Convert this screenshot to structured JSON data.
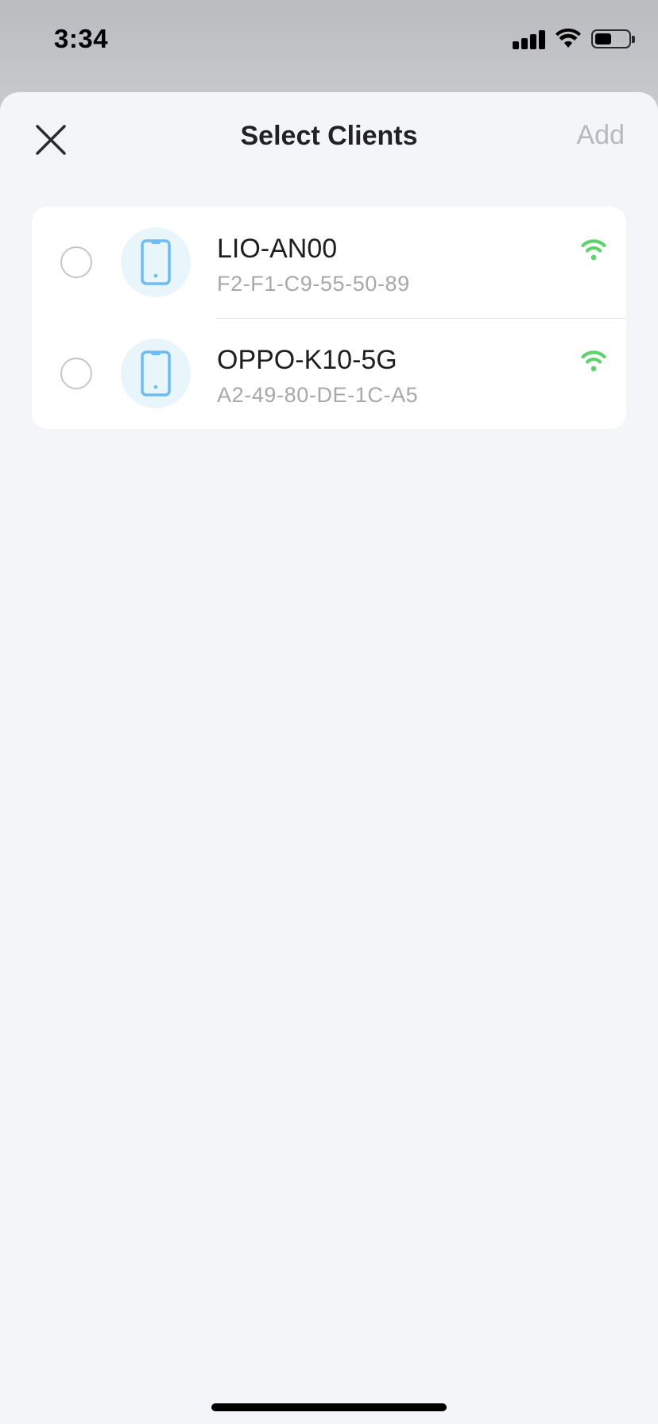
{
  "status_bar": {
    "time": "3:34"
  },
  "header": {
    "title": "Select Clients",
    "add_label": "Add"
  },
  "clients": [
    {
      "name": "LIO-AN00",
      "mac": "F2-F1-C9-55-50-89",
      "selected": false
    },
    {
      "name": "OPPO-K10-5G",
      "mac": "A2-49-80-DE-1C-A5",
      "selected": false
    }
  ],
  "colors": {
    "wifi": "#5fd36b",
    "device_icon": "#6cbcf2",
    "add_disabled": "#b6b9be",
    "background": "#f3f5f9"
  }
}
